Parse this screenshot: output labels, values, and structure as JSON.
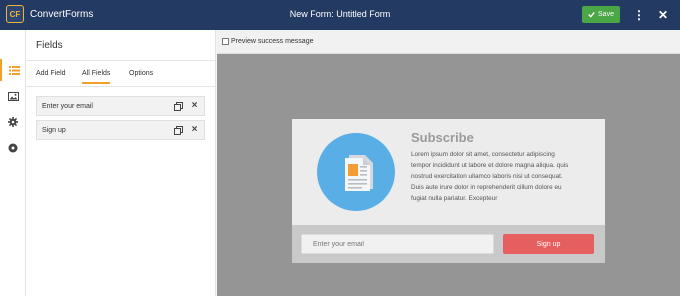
{
  "app": {
    "brand_logo": "CF",
    "brand_name": "ConvertForms",
    "form_title_prefix": "New Form: ",
    "form_title": "Untitled Form",
    "save_label": "Save",
    "accent": "#f0a12b",
    "topbar_color": "#233a63",
    "save_color": "#4ba646"
  },
  "rail": {
    "items": [
      {
        "icon": "list-icon",
        "active": true
      },
      {
        "icon": "image-icon",
        "active": false
      },
      {
        "icon": "gear-icon",
        "active": false
      },
      {
        "icon": "circle-dot-icon",
        "active": false
      }
    ]
  },
  "panel": {
    "title": "Fields",
    "tabs": [
      {
        "label": "Add Field",
        "active": false
      },
      {
        "label": "All Fields",
        "active": true
      },
      {
        "label": "Options",
        "active": false
      }
    ],
    "fields": [
      {
        "label": "Enter your email"
      },
      {
        "label": "Sign up"
      }
    ]
  },
  "canvas": {
    "preview_label": "Preview success message",
    "preview_checked": false
  },
  "form": {
    "headline": "Subscribe",
    "body": "Lorem ipsum dolor sit amet, consectetur adipiscing tempor incididunt ut labore et dolore magna aliqua. quis nostrud exercitation ullamco laboris nisi ut consequat. Duis aute irure dolor in reprehenderit cillum dolore eu fugiat nulla pariatur. Excepteur",
    "email_placeholder": "Enter your email",
    "submit_label": "Sign up",
    "hero_color": "#5aaee6",
    "submit_color": "#e55f5f"
  }
}
